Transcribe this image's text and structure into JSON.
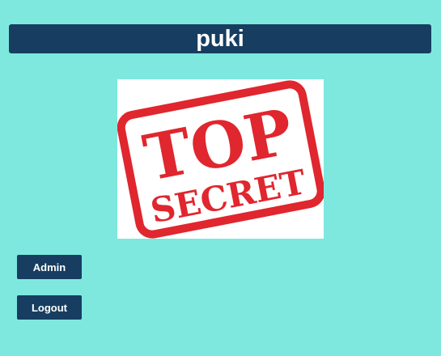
{
  "header": {
    "title": "puki"
  },
  "image": {
    "stamp_text_line1": "TOP",
    "stamp_text_line2": "SECRET",
    "stamp_color": "#e0262e"
  },
  "buttons": {
    "admin_label": "Admin",
    "logout_label": "Logout"
  },
  "colors": {
    "background": "#7ee8df",
    "header_bg": "#173e61",
    "button_bg": "#173e61",
    "text_light": "#ffffff"
  }
}
